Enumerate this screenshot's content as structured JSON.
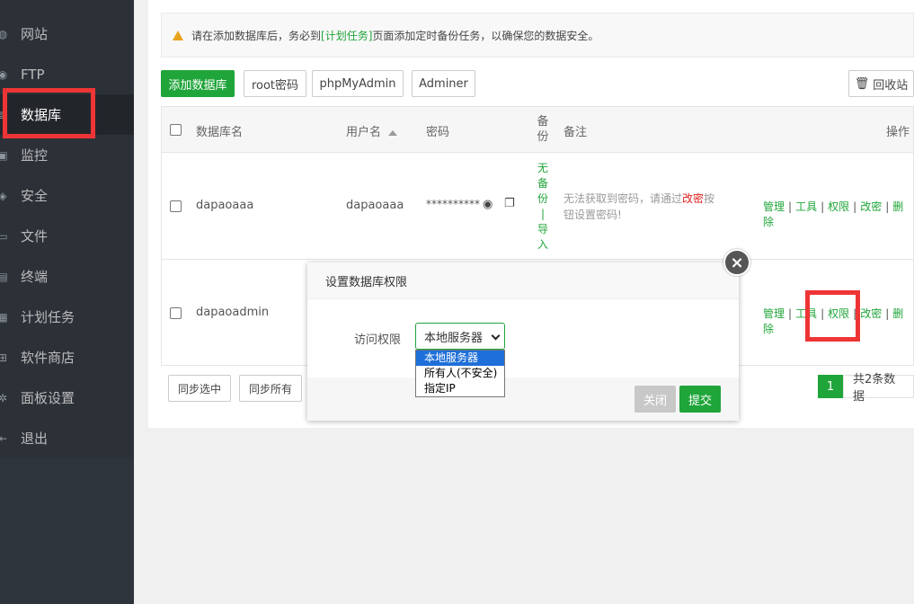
{
  "sidebar": {
    "items": [
      {
        "label": "网站",
        "icon": "globe-icon"
      },
      {
        "label": "FTP",
        "icon": "ftp-icon"
      },
      {
        "label": "数据库",
        "icon": "database-icon",
        "active": true
      },
      {
        "label": "监控",
        "icon": "monitor-icon"
      },
      {
        "label": "安全",
        "icon": "shield-icon"
      },
      {
        "label": "文件",
        "icon": "folder-icon"
      },
      {
        "label": "终端",
        "icon": "terminal-icon"
      },
      {
        "label": "计划任务",
        "icon": "calendar-icon"
      },
      {
        "label": "软件商店",
        "icon": "apps-icon"
      },
      {
        "label": "面板设置",
        "icon": "gear-icon"
      },
      {
        "label": "退出",
        "icon": "logout-icon"
      }
    ]
  },
  "notice": {
    "prefix": "请在添加数据库后，务必到",
    "link": "[计划任务]",
    "suffix": "页面添加定时备份任务，以确保您的数据安全。"
  },
  "toolbar": {
    "add_db": "添加数据库",
    "root_pwd": "root密码",
    "phpmyadmin": "phpMyAdmin",
    "adminer": "Adminer",
    "recycle": "回收站"
  },
  "table": {
    "headers": {
      "name": "数据库名",
      "user": "用户名",
      "password": "密码",
      "backup": "备份",
      "remark": "备注",
      "ops": "操作"
    },
    "rows": [
      {
        "name": "dapaoaaa",
        "user": "dapaoaaa",
        "password": "**********",
        "backup": "无备份|导入",
        "remark_a": "无法获取到密码，请通过",
        "remark_red": "改密",
        "remark_b": "按钮设置密码!"
      },
      {
        "name": "dapaoadmin",
        "user": "",
        "password": "",
        "backup": "",
        "remark_a": "",
        "remark_red": "",
        "remark_b": ""
      }
    ],
    "ops": [
      "管理",
      "工具",
      "权限",
      "改密",
      "删除"
    ],
    "sep": "|"
  },
  "footer": {
    "sync_selected": "同步选中",
    "sync_all": "同步所有",
    "page": "1",
    "total": "共2条数据"
  },
  "dialog": {
    "title": "设置数据库权限",
    "access_label": "访问权限",
    "select_value": "本地服务器",
    "options": [
      "本地服务器",
      "所有人(不安全)",
      "指定IP"
    ],
    "close_label": "关闭",
    "submit_label": "提交",
    "close_glyph": "×"
  },
  "colors": {
    "accent": "#20a53a",
    "sidebar_bg": "#2c3138",
    "highlight": "#ee3535",
    "warning": "#e7a31b"
  }
}
